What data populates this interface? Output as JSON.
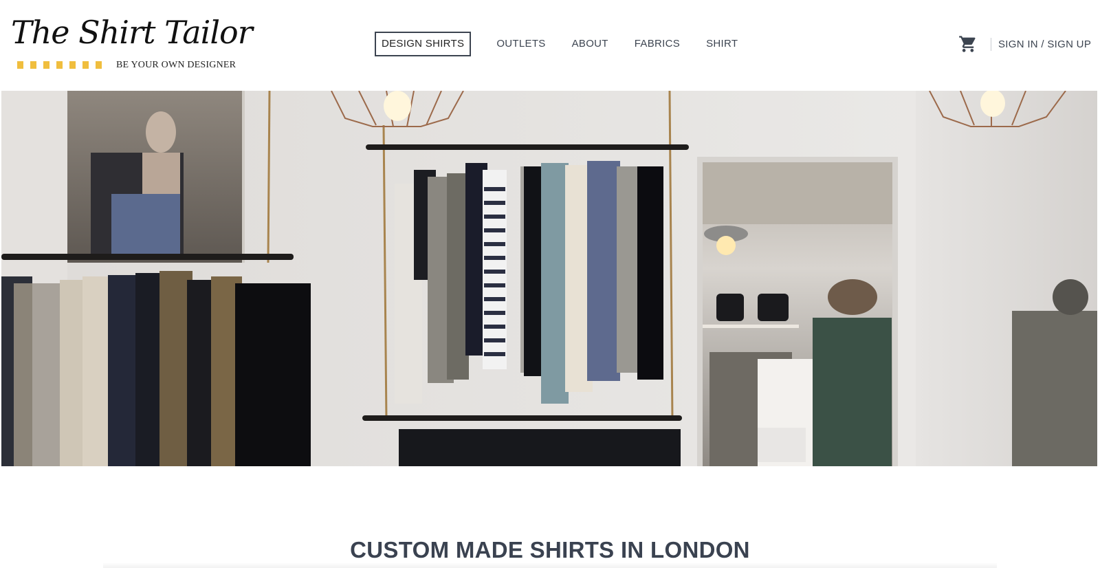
{
  "brand": {
    "name": "The Shirt Tailor",
    "tagline": "BE YOUR OWN DESIGNER",
    "accent_color": "#f0be3e"
  },
  "nav": {
    "items": [
      {
        "label": "DESIGN SHIRTS",
        "active": true
      },
      {
        "label": "OUTLETS",
        "active": false
      },
      {
        "label": "ABOUT",
        "active": false
      },
      {
        "label": "FABRICS",
        "active": false
      },
      {
        "label": "SHIRT",
        "active": false
      }
    ]
  },
  "account": {
    "cart_icon": "shopping-cart-icon",
    "signin_label": "SIGN IN / SIGN UP"
  },
  "hero": {
    "image_subject": "clothing-store-interior"
  },
  "main": {
    "heading": "CUSTOM MADE SHIRTS IN LONDON"
  },
  "colors": {
    "text": "#3c4450",
    "background": "#ffffff"
  }
}
